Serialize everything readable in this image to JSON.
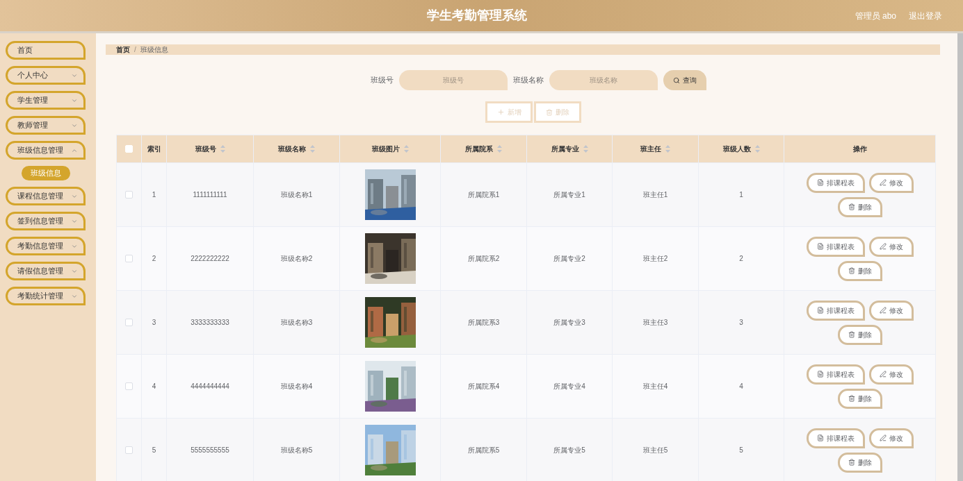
{
  "header": {
    "title": "学生考勤管理系统",
    "user": "管理员 abo",
    "logout": "退出登录"
  },
  "sidebar": {
    "items": [
      {
        "kind": "link",
        "label": "首页"
      },
      {
        "kind": "group",
        "label": "个人中心",
        "expanded": false
      },
      {
        "kind": "group",
        "label": "学生管理",
        "expanded": false
      },
      {
        "kind": "group",
        "label": "教师管理",
        "expanded": false
      },
      {
        "kind": "group",
        "label": "班级信息管理",
        "expanded": true,
        "children": [
          {
            "label": "班级信息",
            "selected": true
          }
        ]
      },
      {
        "kind": "group",
        "label": "课程信息管理",
        "expanded": false
      },
      {
        "kind": "group",
        "label": "签到信息管理",
        "expanded": false
      },
      {
        "kind": "group",
        "label": "考勤信息管理",
        "expanded": false
      },
      {
        "kind": "group",
        "label": "请假信息管理",
        "expanded": false
      },
      {
        "kind": "group",
        "label": "考勤统计管理",
        "expanded": false
      }
    ]
  },
  "breadcrumb": {
    "separator": "/",
    "items": [
      "首页",
      "班级信息"
    ]
  },
  "search": {
    "fields": [
      {
        "label": "班级号",
        "placeholder": "班级号"
      },
      {
        "label": "班级名称",
        "placeholder": "班级名称"
      }
    ],
    "button": "查询"
  },
  "actions": [
    {
      "kind": "add",
      "label": "新增"
    },
    {
      "kind": "delete",
      "label": "删除"
    }
  ],
  "table": {
    "select_all": {
      "checked": false
    },
    "columns": [
      {
        "label": "索引",
        "sortable": false
      },
      {
        "label": "班级号",
        "sortable": true
      },
      {
        "label": "班级名称",
        "sortable": true
      },
      {
        "label": "班级图片",
        "sortable": true
      },
      {
        "label": "所属院系",
        "sortable": true
      },
      {
        "label": "所属专业",
        "sortable": true
      },
      {
        "label": "班主任",
        "sortable": true
      },
      {
        "label": "班级人数",
        "sortable": true
      },
      {
        "label": "操作",
        "sortable": false
      }
    ],
    "rows": [
      {
        "checked": false,
        "cells": [
          "1",
          "1111111111",
          "班级名称1",
          {
            "kind": "picture"
          },
          "所属院系1",
          "所属专业1",
          "班主任1",
          "1"
        ],
        "buttons": [
          {
            "kind": "schedule",
            "label": "排课程表"
          },
          {
            "kind": "edit",
            "label": "修改"
          },
          {
            "kind": "delete",
            "label": "删除"
          }
        ]
      },
      {
        "checked": false,
        "cells": [
          "2",
          "2222222222",
          "班级名称2",
          {
            "kind": "picture"
          },
          "所属院系2",
          "所属专业2",
          "班主任2",
          "2"
        ],
        "buttons": [
          {
            "kind": "schedule",
            "label": "排课程表"
          },
          {
            "kind": "edit",
            "label": "修改"
          },
          {
            "kind": "delete",
            "label": "删除"
          }
        ]
      },
      {
        "checked": false,
        "cells": [
          "3",
          "3333333333",
          "班级名称3",
          {
            "kind": "picture"
          },
          "所属院系3",
          "所属专业3",
          "班主任3",
          "3"
        ],
        "buttons": [
          {
            "kind": "schedule",
            "label": "排课程表"
          },
          {
            "kind": "edit",
            "label": "修改"
          },
          {
            "kind": "delete",
            "label": "删除"
          }
        ]
      },
      {
        "checked": false,
        "cells": [
          "4",
          "4444444444",
          "班级名称4",
          {
            "kind": "picture"
          },
          "所属院系4",
          "所属专业4",
          "班主任4",
          "4"
        ],
        "buttons": [
          {
            "kind": "schedule",
            "label": "排课程表"
          },
          {
            "kind": "edit",
            "label": "修改"
          },
          {
            "kind": "delete",
            "label": "删除"
          }
        ]
      },
      {
        "checked": false,
        "cells": [
          "5",
          "5555555555",
          "班级名称5",
          {
            "kind": "picture"
          },
          "所属院系5",
          "所属专业5",
          "班主任5",
          "5"
        ],
        "buttons": [
          {
            "kind": "schedule",
            "label": "排课程表"
          },
          {
            "kind": "edit",
            "label": "修改"
          },
          {
            "kind": "delete",
            "label": "删除"
          }
        ]
      }
    ]
  }
}
